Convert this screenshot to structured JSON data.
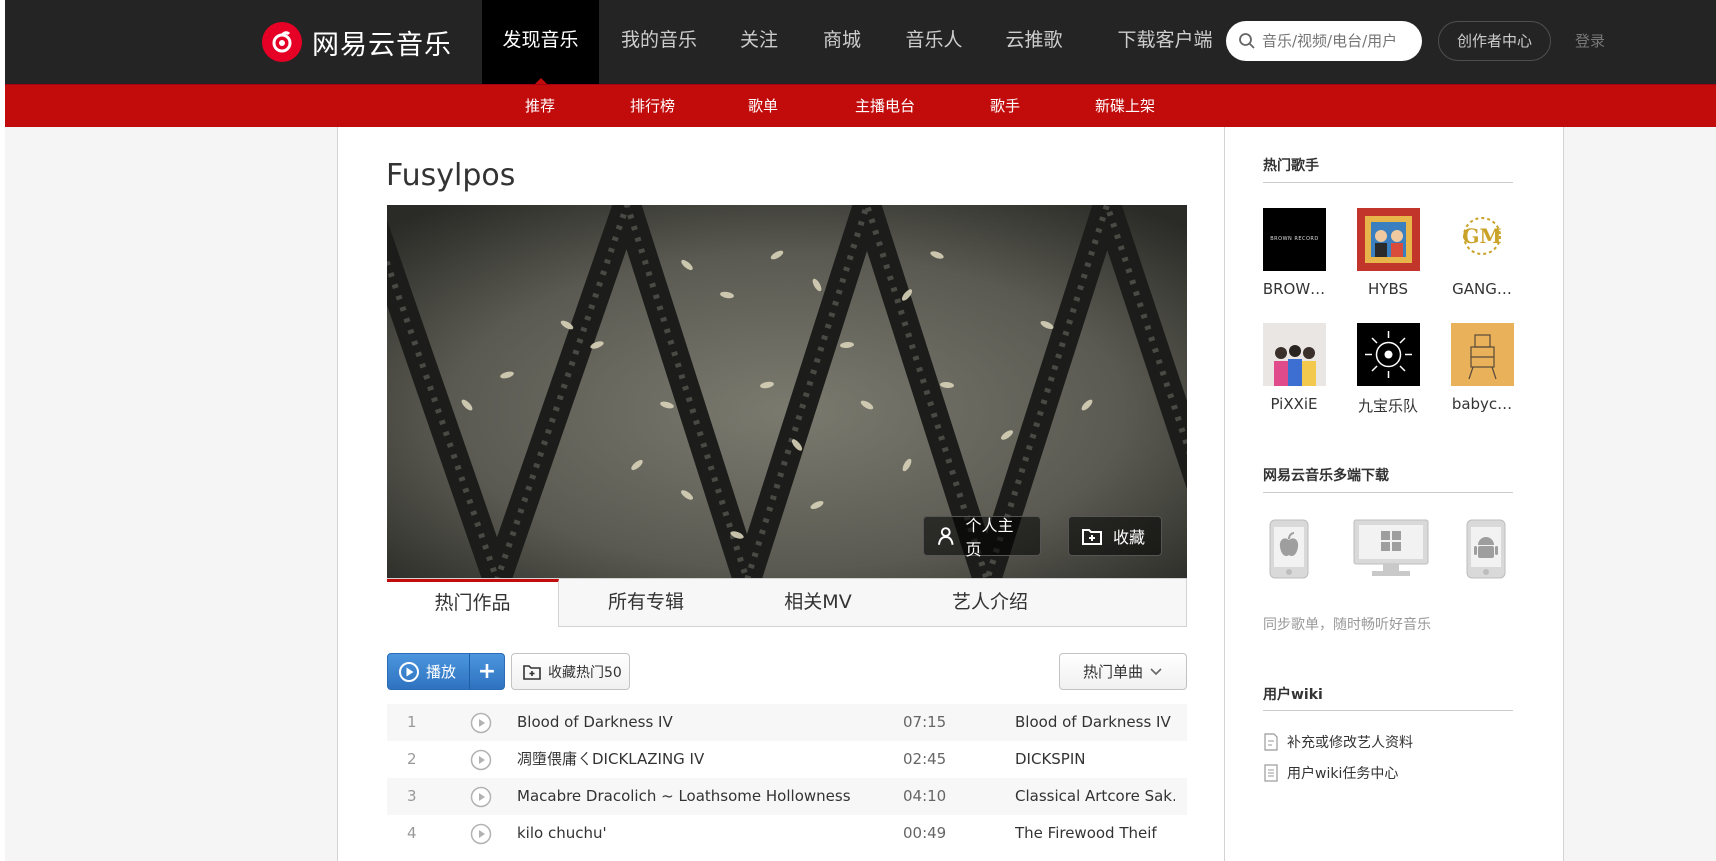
{
  "header": {
    "logo_text": "网易云音乐",
    "nav": [
      "发现音乐",
      "我的音乐",
      "关注",
      "商城",
      "音乐人",
      "云推歌",
      "下载客户端"
    ],
    "search_placeholder": "音乐/视频/电台/用户",
    "creator_center": "创作者中心",
    "login": "登录"
  },
  "subnav": [
    "推荐",
    "排行榜",
    "歌单",
    "主播电台",
    "歌手",
    "新碟上架"
  ],
  "artist": {
    "name": "Fusylpos",
    "homepage_btn": "个人主页",
    "collect_btn": "收藏"
  },
  "tabs": [
    "热门作品",
    "所有专辑",
    "相关MV",
    "艺人介绍"
  ],
  "actions": {
    "play": "播放",
    "collect_top": "收藏热门50",
    "sort": "热门单曲"
  },
  "songs": [
    {
      "index": "1",
      "title": "Blood of Darkness IV",
      "duration": "07:15",
      "album": "Blood of Darkness IV"
    },
    {
      "index": "2",
      "title": "凋墮偎庸ㄑDICKLAZING IV",
      "duration": "02:45",
      "album": "DICKSPIN"
    },
    {
      "index": "3",
      "title": "Macabre Dracolich ~ Loathsome Hollowness",
      "duration": "04:10",
      "album": "Classical Artcore Sak…"
    },
    {
      "index": "4",
      "title": "kilo chuchu'",
      "duration": "00:49",
      "album": "The Firewood Theif"
    }
  ],
  "sidebar": {
    "hot_singers_title": "热门歌手",
    "singers": [
      "BROW…",
      "HYBS",
      "GANG…",
      "PiXXiE",
      "九宝乐队",
      "babyc…"
    ],
    "brown_logo_text": "BROWN RECORD",
    "download_title": "网易云音乐多端下载",
    "download_desc": "同步歌单，随时畅听好音乐",
    "wiki_title": "用户wiki",
    "wiki_items": [
      "补充或修改艺人资料",
      "用户wiki任务中心"
    ]
  },
  "colors": {
    "topbar": "#242424",
    "brand_red": "#c20c0c",
    "play_blue": "#2f73c0"
  }
}
